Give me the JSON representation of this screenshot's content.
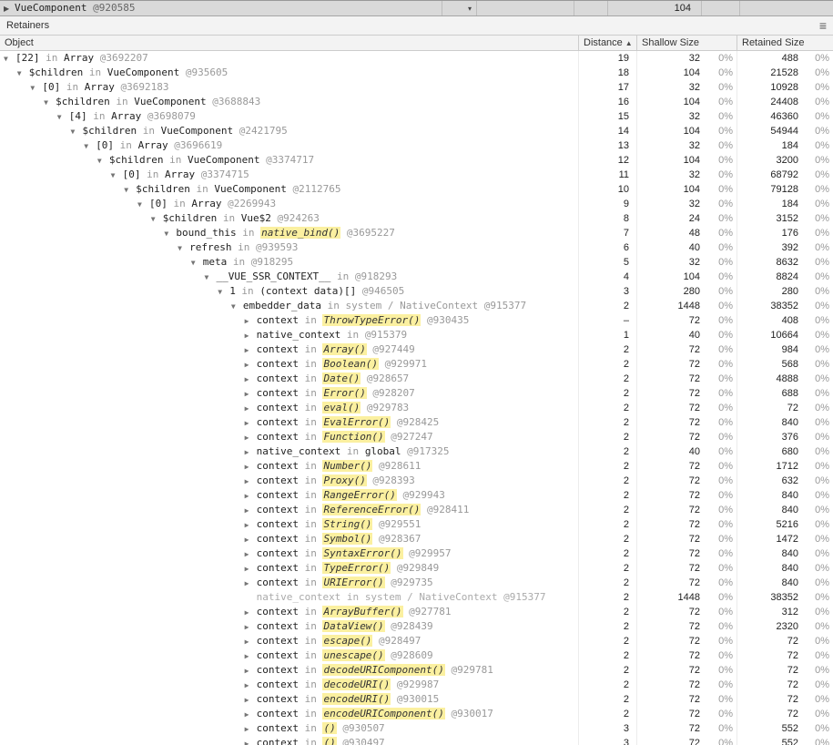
{
  "glyphs": {
    "expanded": "▼",
    "collapsed": "▶",
    "sort_ascending": "▲",
    "menu": "≡",
    "caret": "▾"
  },
  "top_pane": {
    "arrow": "▶",
    "constructor": "VueComponent",
    "id": "@920585",
    "shallow_size": "104"
  },
  "retainers_bar": {
    "title": "Retainers"
  },
  "table": {
    "headers": {
      "object": "Object",
      "distance": "Distance",
      "shallow": "Shallow Size",
      "retained": "Retained Size"
    },
    "separator": "in",
    "rows": [
      {
        "indent": 0,
        "arrow": "expanded",
        "name": "[22]",
        "target": "Array",
        "target_style": "plain",
        "id": "@3692207",
        "distance": "19",
        "shallow": "32",
        "shallow_pct": "0%",
        "retained": "488",
        "retained_pct": "0%"
      },
      {
        "indent": 1,
        "arrow": "expanded",
        "name": "$children",
        "target": "VueComponent",
        "target_style": "plain",
        "id": "@935605",
        "distance": "18",
        "shallow": "104",
        "shallow_pct": "0%",
        "retained": "21528",
        "retained_pct": "0%"
      },
      {
        "indent": 2,
        "arrow": "expanded",
        "name": "[0]",
        "target": "Array",
        "target_style": "plain",
        "id": "@3692183",
        "distance": "17",
        "shallow": "32",
        "shallow_pct": "0%",
        "retained": "10928",
        "retained_pct": "0%"
      },
      {
        "indent": 3,
        "arrow": "expanded",
        "name": "$children",
        "target": "VueComponent",
        "target_style": "plain",
        "id": "@3688843",
        "distance": "16",
        "shallow": "104",
        "shallow_pct": "0%",
        "retained": "24408",
        "retained_pct": "0%"
      },
      {
        "indent": 4,
        "arrow": "expanded",
        "name": "[4]",
        "target": "Array",
        "target_style": "plain",
        "id": "@3698079",
        "distance": "15",
        "shallow": "32",
        "shallow_pct": "0%",
        "retained": "46360",
        "retained_pct": "0%"
      },
      {
        "indent": 5,
        "arrow": "expanded",
        "name": "$children",
        "target": "VueComponent",
        "target_style": "plain",
        "id": "@2421795",
        "distance": "14",
        "shallow": "104",
        "shallow_pct": "0%",
        "retained": "54944",
        "retained_pct": "0%"
      },
      {
        "indent": 6,
        "arrow": "expanded",
        "name": "[0]",
        "target": "Array",
        "target_style": "plain",
        "id": "@3696619",
        "distance": "13",
        "shallow": "32",
        "shallow_pct": "0%",
        "retained": "184",
        "retained_pct": "0%"
      },
      {
        "indent": 7,
        "arrow": "expanded",
        "name": "$children",
        "target": "VueComponent",
        "target_style": "plain",
        "id": "@3374717",
        "distance": "12",
        "shallow": "104",
        "shallow_pct": "0%",
        "retained": "3200",
        "retained_pct": "0%"
      },
      {
        "indent": 8,
        "arrow": "expanded",
        "name": "[0]",
        "target": "Array",
        "target_style": "plain",
        "id": "@3374715",
        "distance": "11",
        "shallow": "32",
        "shallow_pct": "0%",
        "retained": "68792",
        "retained_pct": "0%"
      },
      {
        "indent": 9,
        "arrow": "expanded",
        "name": "$children",
        "target": "VueComponent",
        "target_style": "plain",
        "id": "@2112765",
        "distance": "10",
        "shallow": "104",
        "shallow_pct": "0%",
        "retained": "79128",
        "retained_pct": "0%"
      },
      {
        "indent": 10,
        "arrow": "expanded",
        "name": "[0]",
        "target": "Array",
        "target_style": "plain",
        "id": "@2269943",
        "distance": "9",
        "shallow": "32",
        "shallow_pct": "0%",
        "retained": "184",
        "retained_pct": "0%"
      },
      {
        "indent": 11,
        "arrow": "expanded",
        "name": "$children",
        "target": "Vue$2",
        "target_style": "plain",
        "id": "@924263",
        "distance": "8",
        "shallow": "24",
        "shallow_pct": "0%",
        "retained": "3152",
        "retained_pct": "0%"
      },
      {
        "indent": 12,
        "arrow": "expanded",
        "name": "bound_this",
        "target": "native_bind()",
        "target_style": "highlight",
        "id": "@3695227",
        "distance": "7",
        "shallow": "48",
        "shallow_pct": "0%",
        "retained": "176",
        "retained_pct": "0%"
      },
      {
        "indent": 13,
        "arrow": "expanded",
        "name": "refresh",
        "target": "",
        "target_style": "",
        "id": "@939593",
        "distance": "6",
        "shallow": "40",
        "shallow_pct": "0%",
        "retained": "392",
        "retained_pct": "0%"
      },
      {
        "indent": 14,
        "arrow": "expanded",
        "name": "meta",
        "target": "",
        "target_style": "",
        "id": "@918295",
        "distance": "5",
        "shallow": "32",
        "shallow_pct": "0%",
        "retained": "8632",
        "retained_pct": "0%"
      },
      {
        "indent": 15,
        "arrow": "expanded",
        "name": "__VUE_SSR_CONTEXT__",
        "target": "",
        "target_style": "",
        "id": "@918293",
        "distance": "4",
        "shallow": "104",
        "shallow_pct": "0%",
        "retained": "8824",
        "retained_pct": "0%"
      },
      {
        "indent": 16,
        "arrow": "expanded",
        "name": "1",
        "target": "(context data)[]",
        "target_style": "plain",
        "id": "@946505",
        "distance": "3",
        "shallow": "280",
        "shallow_pct": "0%",
        "retained": "280",
        "retained_pct": "0%"
      },
      {
        "indent": 17,
        "arrow": "expanded",
        "name": "embedder_data",
        "target": "system / NativeContext",
        "target_style": "gray",
        "id": "@915377",
        "distance": "2",
        "shallow": "1448",
        "shallow_pct": "0%",
        "retained": "38352",
        "retained_pct": "0%"
      },
      {
        "indent": 18,
        "arrow": "collapsed",
        "name": "context",
        "target": "ThrowTypeError()",
        "target_style": "highlight",
        "id": "@930435",
        "distance": "–",
        "shallow": "72",
        "shallow_pct": "0%",
        "retained": "408",
        "retained_pct": "0%"
      },
      {
        "indent": 18,
        "arrow": "collapsed",
        "name": "native_context",
        "target": "",
        "target_style": "",
        "id": "@915379",
        "distance": "1",
        "shallow": "40",
        "shallow_pct": "0%",
        "retained": "10664",
        "retained_pct": "0%"
      },
      {
        "indent": 18,
        "arrow": "collapsed",
        "name": "context",
        "target": "Array()",
        "target_style": "highlight",
        "id": "@927449",
        "distance": "2",
        "shallow": "72",
        "shallow_pct": "0%",
        "retained": "984",
        "retained_pct": "0%"
      },
      {
        "indent": 18,
        "arrow": "collapsed",
        "name": "context",
        "target": "Boolean()",
        "target_style": "highlight",
        "id": "@929971",
        "distance": "2",
        "shallow": "72",
        "shallow_pct": "0%",
        "retained": "568",
        "retained_pct": "0%"
      },
      {
        "indent": 18,
        "arrow": "collapsed",
        "name": "context",
        "target": "Date()",
        "target_style": "highlight",
        "id": "@928657",
        "distance": "2",
        "shallow": "72",
        "shallow_pct": "0%",
        "retained": "4888",
        "retained_pct": "0%"
      },
      {
        "indent": 18,
        "arrow": "collapsed",
        "name": "context",
        "target": "Error()",
        "target_style": "highlight",
        "id": "@928207",
        "distance": "2",
        "shallow": "72",
        "shallow_pct": "0%",
        "retained": "688",
        "retained_pct": "0%"
      },
      {
        "indent": 18,
        "arrow": "collapsed",
        "name": "context",
        "target": "eval()",
        "target_style": "highlight",
        "id": "@929783",
        "distance": "2",
        "shallow": "72",
        "shallow_pct": "0%",
        "retained": "72",
        "retained_pct": "0%"
      },
      {
        "indent": 18,
        "arrow": "collapsed",
        "name": "context",
        "target": "EvalError()",
        "target_style": "highlight",
        "id": "@928425",
        "distance": "2",
        "shallow": "72",
        "shallow_pct": "0%",
        "retained": "840",
        "retained_pct": "0%"
      },
      {
        "indent": 18,
        "arrow": "collapsed",
        "name": "context",
        "target": "Function()",
        "target_style": "highlight",
        "id": "@927247",
        "distance": "2",
        "shallow": "72",
        "shallow_pct": "0%",
        "retained": "376",
        "retained_pct": "0%"
      },
      {
        "indent": 18,
        "arrow": "collapsed",
        "name": "native_context",
        "target": "global",
        "target_style": "plain",
        "id": "@917325",
        "distance": "2",
        "shallow": "40",
        "shallow_pct": "0%",
        "retained": "680",
        "retained_pct": "0%"
      },
      {
        "indent": 18,
        "arrow": "collapsed",
        "name": "context",
        "target": "Number()",
        "target_style": "highlight",
        "id": "@928611",
        "distance": "2",
        "shallow": "72",
        "shallow_pct": "0%",
        "retained": "1712",
        "retained_pct": "0%"
      },
      {
        "indent": 18,
        "arrow": "collapsed",
        "name": "context",
        "target": "Proxy()",
        "target_style": "highlight",
        "id": "@928393",
        "distance": "2",
        "shallow": "72",
        "shallow_pct": "0%",
        "retained": "632",
        "retained_pct": "0%"
      },
      {
        "indent": 18,
        "arrow": "collapsed",
        "name": "context",
        "target": "RangeError()",
        "target_style": "highlight",
        "id": "@929943",
        "distance": "2",
        "shallow": "72",
        "shallow_pct": "0%",
        "retained": "840",
        "retained_pct": "0%"
      },
      {
        "indent": 18,
        "arrow": "collapsed",
        "name": "context",
        "target": "ReferenceError()",
        "target_style": "highlight",
        "id": "@928411",
        "distance": "2",
        "shallow": "72",
        "shallow_pct": "0%",
        "retained": "840",
        "retained_pct": "0%"
      },
      {
        "indent": 18,
        "arrow": "collapsed",
        "name": "context",
        "target": "String()",
        "target_style": "highlight",
        "id": "@929551",
        "distance": "2",
        "shallow": "72",
        "shallow_pct": "0%",
        "retained": "5216",
        "retained_pct": "0%"
      },
      {
        "indent": 18,
        "arrow": "collapsed",
        "name": "context",
        "target": "Symbol()",
        "target_style": "highlight",
        "id": "@928367",
        "distance": "2",
        "shallow": "72",
        "shallow_pct": "0%",
        "retained": "1472",
        "retained_pct": "0%"
      },
      {
        "indent": 18,
        "arrow": "collapsed",
        "name": "context",
        "target": "SyntaxError()",
        "target_style": "highlight",
        "id": "@929957",
        "distance": "2",
        "shallow": "72",
        "shallow_pct": "0%",
        "retained": "840",
        "retained_pct": "0%"
      },
      {
        "indent": 18,
        "arrow": "collapsed",
        "name": "context",
        "target": "TypeError()",
        "target_style": "highlight",
        "id": "@929849",
        "distance": "2",
        "shallow": "72",
        "shallow_pct": "0%",
        "retained": "840",
        "retained_pct": "0%"
      },
      {
        "indent": 18,
        "arrow": "collapsed",
        "name": "context",
        "target": "URIError()",
        "target_style": "highlight",
        "id": "@929735",
        "distance": "2",
        "shallow": "72",
        "shallow_pct": "0%",
        "retained": "840",
        "retained_pct": "0%"
      },
      {
        "indent": 18,
        "arrow": "none",
        "name": "native_context",
        "target": "system / NativeContext",
        "target_style": "gray",
        "id": "@915377",
        "gray": true,
        "distance": "2",
        "shallow": "1448",
        "shallow_pct": "0%",
        "retained": "38352",
        "retained_pct": "0%"
      },
      {
        "indent": 18,
        "arrow": "collapsed",
        "name": "context",
        "target": "ArrayBuffer()",
        "target_style": "highlight",
        "id": "@927781",
        "distance": "2",
        "shallow": "72",
        "shallow_pct": "0%",
        "retained": "312",
        "retained_pct": "0%"
      },
      {
        "indent": 18,
        "arrow": "collapsed",
        "name": "context",
        "target": "DataView()",
        "target_style": "highlight",
        "id": "@928439",
        "distance": "2",
        "shallow": "72",
        "shallow_pct": "0%",
        "retained": "2320",
        "retained_pct": "0%"
      },
      {
        "indent": 18,
        "arrow": "collapsed",
        "name": "context",
        "target": "escape()",
        "target_style": "highlight",
        "id": "@928497",
        "distance": "2",
        "shallow": "72",
        "shallow_pct": "0%",
        "retained": "72",
        "retained_pct": "0%"
      },
      {
        "indent": 18,
        "arrow": "collapsed",
        "name": "context",
        "target": "unescape()",
        "target_style": "highlight",
        "id": "@928609",
        "distance": "2",
        "shallow": "72",
        "shallow_pct": "0%",
        "retained": "72",
        "retained_pct": "0%"
      },
      {
        "indent": 18,
        "arrow": "collapsed",
        "name": "context",
        "target": "decodeURIComponent()",
        "target_style": "highlight",
        "id": "@929781",
        "distance": "2",
        "shallow": "72",
        "shallow_pct": "0%",
        "retained": "72",
        "retained_pct": "0%"
      },
      {
        "indent": 18,
        "arrow": "collapsed",
        "name": "context",
        "target": "decodeURI()",
        "target_style": "highlight",
        "id": "@929987",
        "distance": "2",
        "shallow": "72",
        "shallow_pct": "0%",
        "retained": "72",
        "retained_pct": "0%"
      },
      {
        "indent": 18,
        "arrow": "collapsed",
        "name": "context",
        "target": "encodeURI()",
        "target_style": "highlight",
        "id": "@930015",
        "distance": "2",
        "shallow": "72",
        "shallow_pct": "0%",
        "retained": "72",
        "retained_pct": "0%"
      },
      {
        "indent": 18,
        "arrow": "collapsed",
        "name": "context",
        "target": "encodeURIComponent()",
        "target_style": "highlight",
        "id": "@930017",
        "distance": "2",
        "shallow": "72",
        "shallow_pct": "0%",
        "retained": "72",
        "retained_pct": "0%"
      },
      {
        "indent": 18,
        "arrow": "collapsed",
        "name": "context",
        "target": "()",
        "target_style": "highlight",
        "id": "@930507",
        "distance": "3",
        "shallow": "72",
        "shallow_pct": "0%",
        "retained": "552",
        "retained_pct": "0%"
      },
      {
        "indent": 18,
        "arrow": "collapsed",
        "name": "context",
        "target": "()",
        "target_style": "highlight",
        "id": "@930497",
        "distance": "3",
        "shallow": "72",
        "shallow_pct": "0%",
        "retained": "552",
        "retained_pct": "0%"
      }
    ]
  }
}
